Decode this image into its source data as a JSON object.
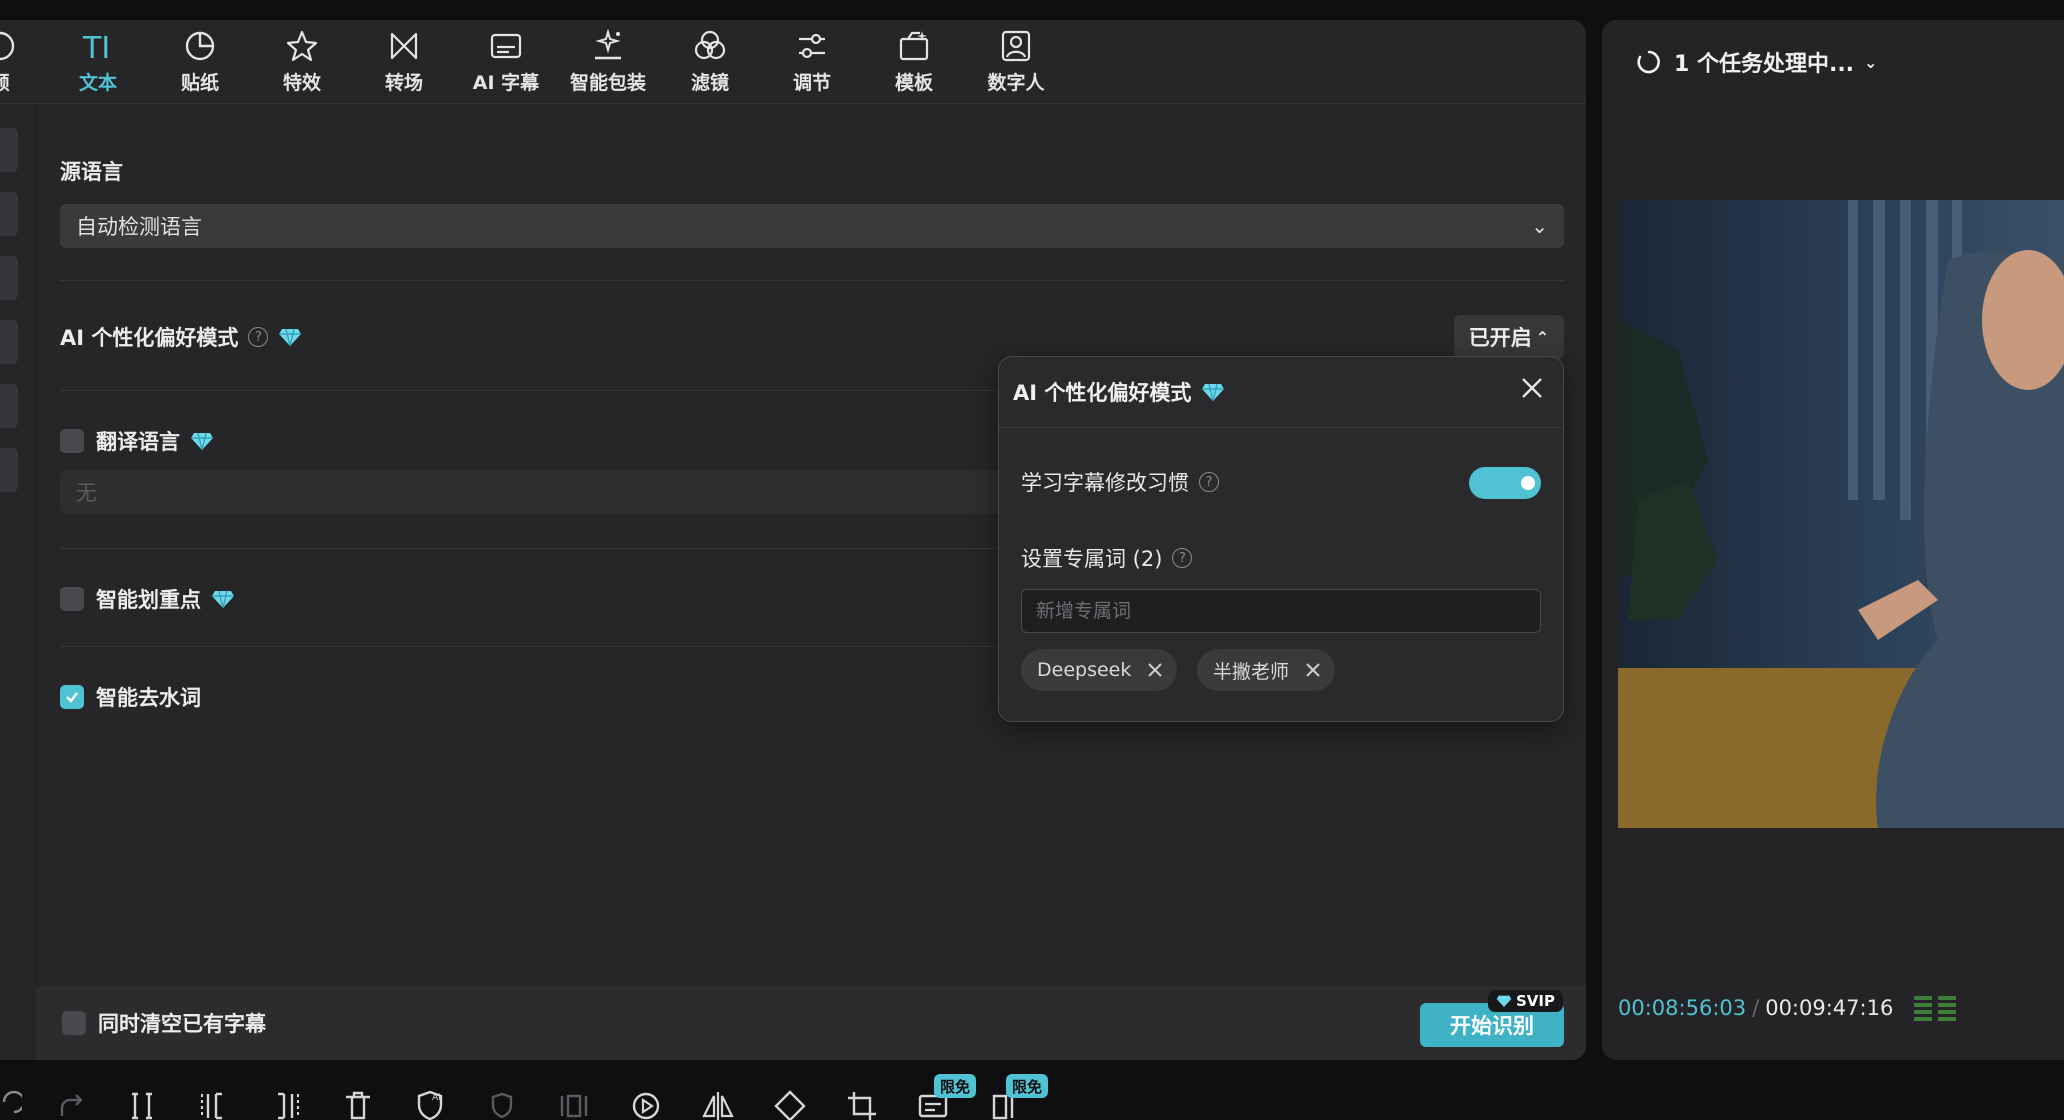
{
  "toolbar": {
    "tabs": [
      {
        "label": "频",
        "icon": "circle-partial-icon"
      },
      {
        "label": "文本",
        "icon": "text-icon",
        "active": true
      },
      {
        "label": "贴纸",
        "icon": "sticker-icon"
      },
      {
        "label": "特效",
        "icon": "star-icon"
      },
      {
        "label": "转场",
        "icon": "transition-icon"
      },
      {
        "label": "AI 字幕",
        "icon": "subtitle-icon"
      },
      {
        "label": "智能包装",
        "icon": "smart-package-icon"
      },
      {
        "label": "滤镜",
        "icon": "filter-icon"
      },
      {
        "label": "调节",
        "icon": "adjust-icon"
      },
      {
        "label": "模板",
        "icon": "template-icon"
      },
      {
        "label": "数字人",
        "icon": "digital-human-icon"
      }
    ]
  },
  "form": {
    "source_language_label": "源语言",
    "source_language_value": "自动检测语言",
    "ai_pref_label": "AI 个性化偏好模式",
    "ai_pref_status": "已开启",
    "translate_label": "翻译语言",
    "translate_value": "无",
    "highlight_label": "智能划重点",
    "remove_filler_label": "智能去水词"
  },
  "footer": {
    "clear_existing_label": "同时清空已有字幕",
    "start_button": "开始识别",
    "svip_badge": "SVIP"
  },
  "popup": {
    "title": "AI 个性化偏好模式",
    "learn_habits_label": "学习字幕修改习惯",
    "custom_terms_label": "设置专属词 (2)",
    "term_placeholder": "新增专属词",
    "tags": [
      "Deepseek",
      "半撇老师"
    ]
  },
  "preview": {
    "task_status": "1 个任务处理中...",
    "current_time": "00:08:56:03",
    "separator": "/",
    "total_time": "00:09:47:16"
  },
  "bottom_bar": {
    "free_badges": [
      "限免",
      "限免"
    ]
  },
  "colors": {
    "accent": "#4fc3d4",
    "panel": "#262628",
    "background": "#0f0f11"
  }
}
